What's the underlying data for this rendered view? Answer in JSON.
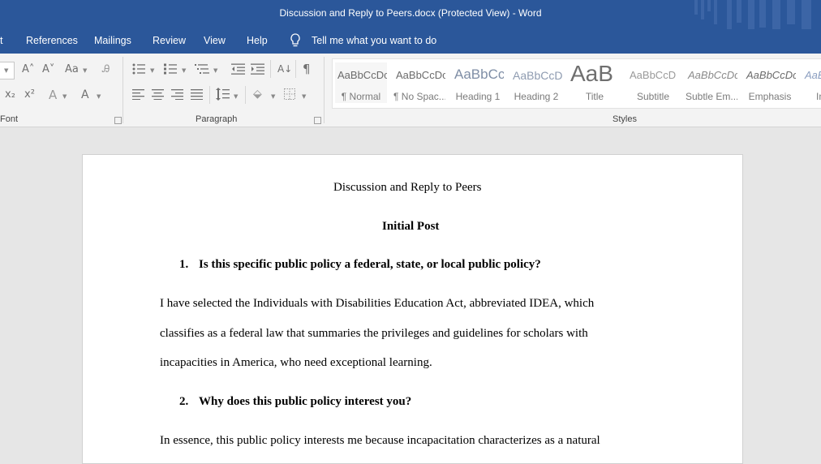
{
  "window": {
    "title": "Discussion and Reply to Peers.docx (Protected View)  -  Word"
  },
  "menu": {
    "items": [
      "t",
      "References",
      "Mailings",
      "Review",
      "View",
      "Help"
    ],
    "tell_me": "Tell me what you want to do"
  },
  "ribbon": {
    "font_group_label": "Font",
    "paragraph_group_label": "Paragraph",
    "styles_group_label": "Styles",
    "font_buttons": {
      "grow": "A˄",
      "shrink": "A˅",
      "change_case": "Aa",
      "subscript": "x₂",
      "superscript": "x²",
      "text_effects": "A",
      "font_color": "A"
    },
    "styles": [
      {
        "preview": "AaBbCcDc",
        "name": "¶ Normal"
      },
      {
        "preview": "AaBbCcDc",
        "name": "¶ No Spac..."
      },
      {
        "preview": "AaBbCc",
        "name": "Heading 1"
      },
      {
        "preview": "AaBbCcD",
        "name": "Heading 2"
      },
      {
        "preview": "AaB",
        "name": "Title"
      },
      {
        "preview": "AaBbCcD",
        "name": "Subtitle"
      },
      {
        "preview": "AaBbCcDc",
        "name": "Subtle Em..."
      },
      {
        "preview": "AaBbCcDc",
        "name": "Emphasis"
      },
      {
        "preview": "AaBbCcDc",
        "name": "Inte..."
      }
    ]
  },
  "document": {
    "title": "Discussion and Reply to Peers",
    "section_heading": "Initial Post",
    "q1_number": "1.",
    "q1_text": "Is this specific public policy a federal, state, or local public policy?",
    "p1_line1": "I have selected the Individuals with Disabilities Education Act, abbreviated IDEA, which",
    "p1_line2": "classifies as a federal law that summaries the privileges and guidelines for scholars with",
    "p1_line3": "incapacities in America, who need exceptional learning.",
    "q2_number": "2.",
    "q2_text": "Why does this public policy interest you?",
    "p2_line1": "In essence, this public policy interests me because incapacitation characterizes as a natural"
  }
}
